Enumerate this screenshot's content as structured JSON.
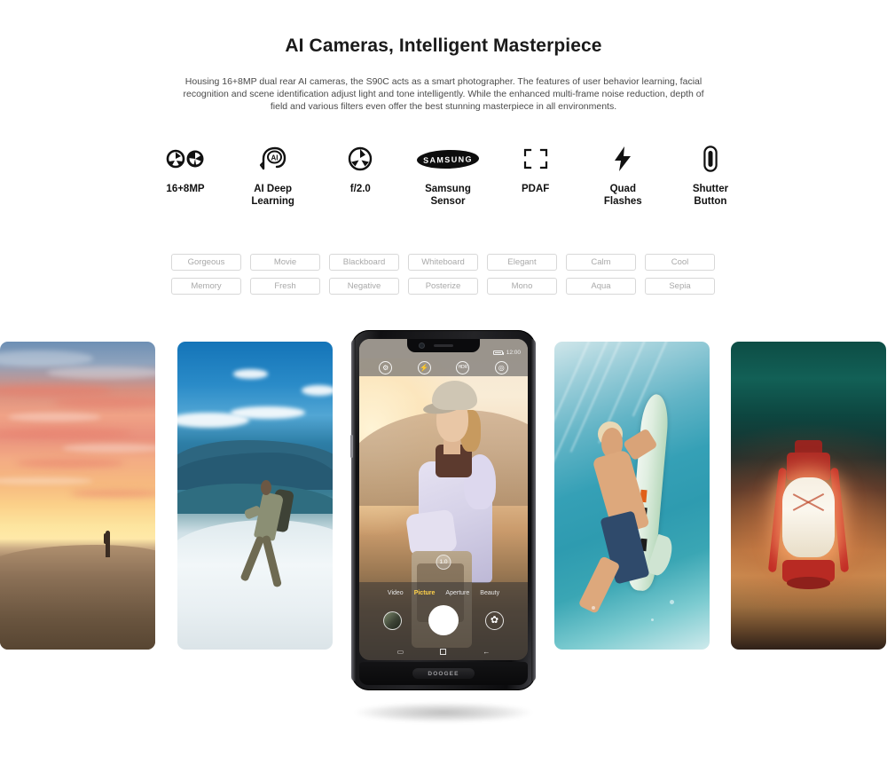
{
  "header": {
    "title": "AI Cameras, Intelligent Masterpiece",
    "description": "Housing 16+8MP dual rear AI cameras, the S90C acts as a smart photographer. The features of user behavior learning, facial recognition and scene identification adjust light and tone intelligently. While the enhanced multi-frame noise reduction, depth of field and various filters even offer the best stunning masterpiece in all environments."
  },
  "features": [
    {
      "icon": "dual-aperture-icon",
      "label": "16+8MP"
    },
    {
      "icon": "ai-brain-icon",
      "label": "AI Deep\nLearning",
      "line1": "AI Deep",
      "line2": "Learning"
    },
    {
      "icon": "aperture-icon",
      "label": "f/2.0"
    },
    {
      "icon": "samsung-logo-icon",
      "brand": "SAMSUNG",
      "line1": "Samsung",
      "line2": "Sensor"
    },
    {
      "icon": "focus-frame-icon",
      "label": "PDAF"
    },
    {
      "icon": "lightning-bolt-icon",
      "line1": "Quad",
      "line2": "Flashes"
    },
    {
      "icon": "shutter-button-icon",
      "line1": "Shutter",
      "line2": "Button"
    }
  ],
  "filters": {
    "row1": [
      "Gorgeous",
      "Movie",
      "Blackboard",
      "Whiteboard",
      "Elegant",
      "Calm",
      "Cool"
    ],
    "row2": [
      "Memory",
      "Fresh",
      "Negative",
      "Posterize",
      "Mono",
      "Aqua",
      "Sepia"
    ]
  },
  "gallery": [
    {
      "name": "desert-sunset-photo",
      "alt": "Person silhouetted on sand dune at sunset"
    },
    {
      "name": "mountain-hiker-photo",
      "alt": "Hiker climbing snowy mountain ridge"
    },
    {
      "name": "surfer-underwater-photo",
      "alt": "Surfer diving underwater holding surfboard"
    },
    {
      "name": "red-lantern-photo",
      "alt": "Glowing red lantern on sand at night"
    }
  ],
  "phone": {
    "brand": "DOOGEE",
    "status": {
      "time": "12:00",
      "battery_icon": "battery-icon"
    },
    "top_controls": [
      {
        "name": "settings-icon",
        "glyph": "⚙"
      },
      {
        "name": "flash-icon",
        "glyph": "⚡"
      },
      {
        "name": "hdr-icon",
        "glyph": "HDR"
      },
      {
        "name": "switch-camera-icon",
        "glyph": "◎"
      }
    ],
    "zoom_level": "1.0",
    "modes": [
      {
        "label": "Video",
        "active": false
      },
      {
        "label": "Picture",
        "active": true
      },
      {
        "label": "Aperture",
        "active": false
      },
      {
        "label": "Beauty",
        "active": false
      }
    ],
    "controls": {
      "gallery_thumb": "gallery-thumbnail",
      "shutter": "shutter-button",
      "filter": "filter-button",
      "filter_glyph": "✿"
    },
    "navbar": [
      {
        "name": "recents-icon",
        "glyph": "▭"
      },
      {
        "name": "home-icon",
        "glyph": "□"
      },
      {
        "name": "back-icon",
        "glyph": "←"
      }
    ],
    "viewfinder_subject": "Smiling woman wearing cap and lavender jacket at golden hour"
  },
  "colors": {
    "accent_yellow": "#ffd24a",
    "text_dark": "#1a1a1a",
    "text_body": "#4a4a4a",
    "chip_border": "#d8d8d8",
    "chip_text": "#a9a9a9"
  }
}
